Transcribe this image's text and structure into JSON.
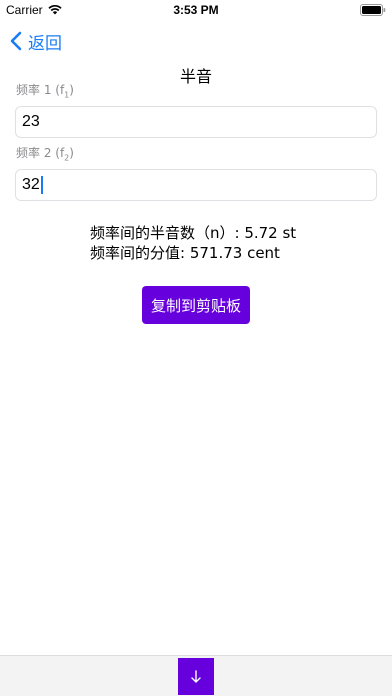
{
  "status_bar": {
    "carrier": "Carrier",
    "time": "3:53 PM"
  },
  "nav": {
    "back_label": "返回",
    "title": "半音"
  },
  "fields": [
    {
      "label": "频率 1 (f",
      "label_sub": "1",
      "label_end": ")",
      "value": "23"
    },
    {
      "label": "频率 2 (f",
      "label_sub": "2",
      "label_end": ")",
      "value": "32"
    }
  ],
  "results": {
    "semitones": "频率间的半音数（n）: 5.72 st",
    "cents": "频率间的分值: 571.73 cent"
  },
  "copy_button_label": "复制到剪贴板",
  "bottom": {
    "down_button_icon": "arrow-down-icon"
  },
  "colors": {
    "accent_blue": "#1a7cf5",
    "button_purple": "#6600dd"
  }
}
